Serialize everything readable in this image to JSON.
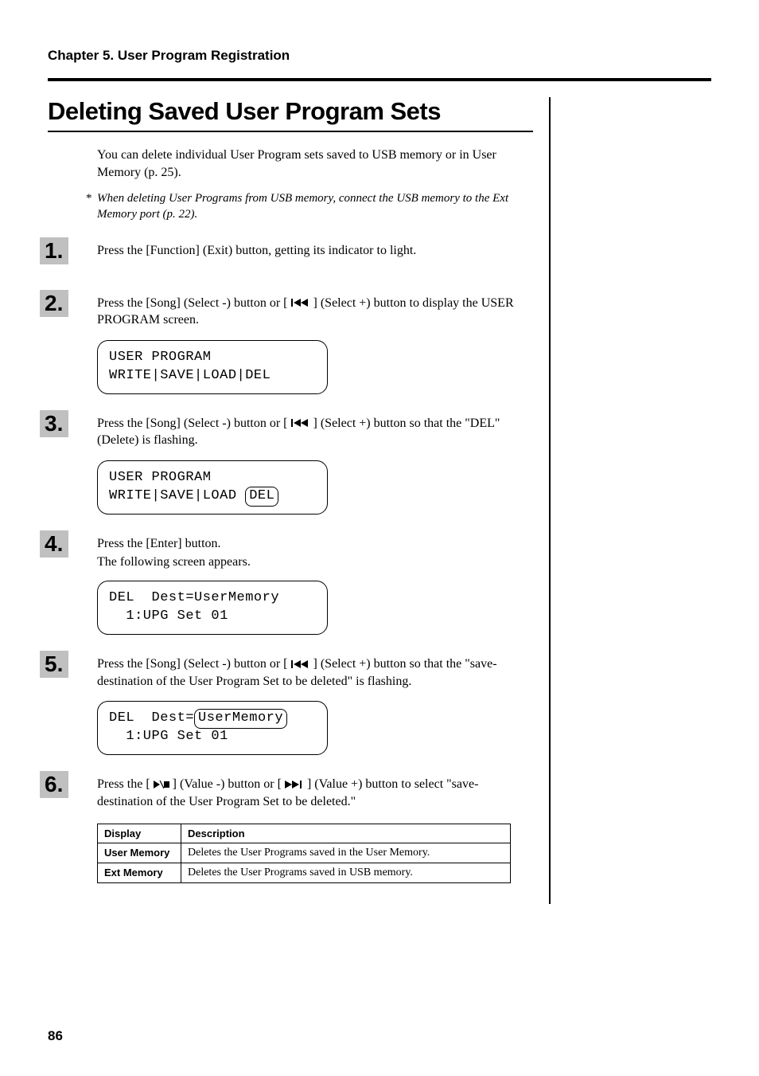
{
  "chapter_header": "Chapter 5. User Program Registration",
  "section_title": "Deleting Saved User Program Sets",
  "intro": "You can delete individual User Program sets saved to USB memory or in User Memory (p. 25).",
  "note": "When deleting User Programs from USB memory, connect the USB memory to the Ext Memory port (p. 22).",
  "steps": {
    "s1": {
      "num": "1.",
      "text": "Press the [Function] (Exit) button, getting its indicator to light."
    },
    "s2": {
      "num": "2.",
      "pre": "Press the [Song] (Select -) button or [ ",
      "post": " ] (Select +) button to display the USER PROGRAM screen.",
      "lcd_l1": "USER PROGRAM",
      "lcd_l2": "WRITE|SAVE|LOAD|DEL"
    },
    "s3": {
      "num": "3.",
      "pre": "Press the [Song] (Select -) button or [ ",
      "post": " ] (Select +) button so that the \"DEL\" (Delete) is flashing.",
      "lcd_l1": "USER PROGRAM",
      "lcd_l2a": "WRITE|SAVE|LOAD",
      "lcd_l2b": "DEL"
    },
    "s4": {
      "num": "4.",
      "text": "Press the [Enter] button.",
      "sub": "The following screen appears.",
      "lcd_l1": "DEL  Dest=UserMemory",
      "lcd_l2": "  1:UPG Set 01"
    },
    "s5": {
      "num": "5.",
      "pre": "Press the [Song] (Select -) button or [ ",
      "post": " ] (Select +) button so that the \"save-destination of the User Program Set to be deleted\" is flashing.",
      "lcd_l1a": "DEL  Dest=",
      "lcd_l1b": "UserMemory",
      "lcd_l2": "  1:UPG Set 01"
    },
    "s6": {
      "num": "6.",
      "pre": "Press the [ ",
      "mid": " ] (Value -) button or [ ",
      "post": " ] (Value +) button to select \"save-destination of the User Program Set to be deleted.\""
    }
  },
  "table": {
    "headers": {
      "c1": "Display",
      "c2": "Description"
    },
    "rows": [
      {
        "c1": "User Memory",
        "c2": "Deletes the User Programs saved in the User Memory."
      },
      {
        "c1": "Ext Memory",
        "c2": "Deletes the User Programs saved in USB memory."
      }
    ]
  },
  "page_number": "86"
}
